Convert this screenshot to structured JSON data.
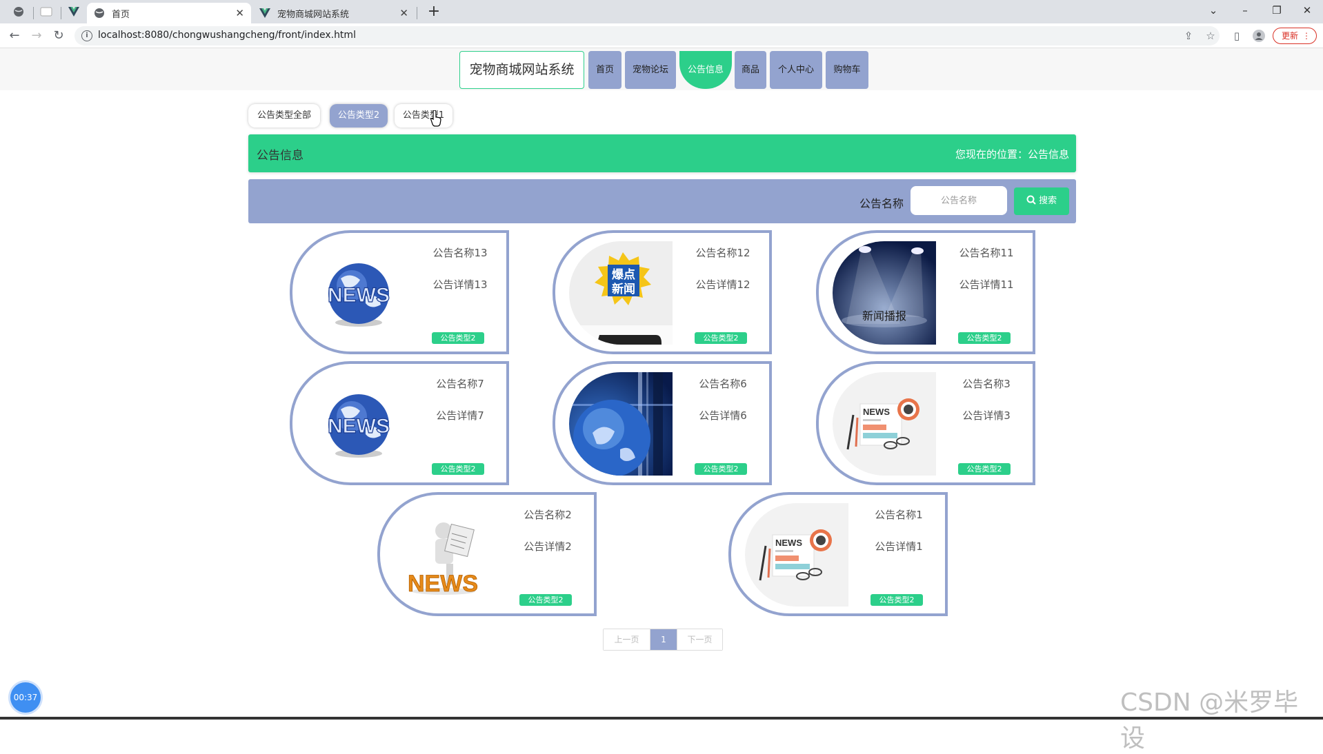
{
  "browser": {
    "tabs": [
      {
        "title": "首页",
        "icon": "globe-icon"
      },
      {
        "title": "宠物商城网站系统",
        "icon": "vue-icon"
      }
    ],
    "url": "localhost:8080/chongwushangcheng/front/index.html",
    "update_label": "更新"
  },
  "header": {
    "brand": "宠物商城网站系统",
    "nav": [
      "首页",
      "宠物论坛",
      "公告信息",
      "商品",
      "个人中心",
      "购物车"
    ],
    "active_nav": "公告信息"
  },
  "filters": {
    "chips": [
      "公告类型全部",
      "公告类型2",
      "公告类型1"
    ],
    "active": "公告类型2"
  },
  "titlebar": {
    "title": "公告信息",
    "location": "您现在的位置：公告信息"
  },
  "search": {
    "label": "公告名称",
    "placeholder": "公告名称",
    "button": "搜索"
  },
  "cards": [
    {
      "name": "公告名称13",
      "detail": "公告详情13",
      "tag": "公告类型2",
      "image": "news-globe"
    },
    {
      "name": "公告名称12",
      "detail": "公告详情12",
      "tag": "公告类型2",
      "image": "explosive-news"
    },
    {
      "name": "公告名称11",
      "detail": "公告详情11",
      "tag": "公告类型2",
      "image": "spotlight-stage",
      "image_text": "新闻播报"
    },
    {
      "name": "公告名称7",
      "detail": "公告详情7",
      "tag": "公告类型2",
      "image": "news-globe"
    },
    {
      "name": "公告名称6",
      "detail": "公告详情6",
      "tag": "公告类型2",
      "image": "earth-broadcast"
    },
    {
      "name": "公告名称3",
      "detail": "公告详情3",
      "tag": "公告类型2",
      "image": "newspaper-glasses"
    },
    {
      "name": "公告名称2",
      "detail": "公告详情2",
      "tag": "公告类型2",
      "image": "man-reading-news"
    },
    {
      "name": "公告名称1",
      "detail": "公告详情1",
      "tag": "公告类型2",
      "image": "newspaper-glasses"
    }
  ],
  "pagination": {
    "prev": "上一页",
    "current": "1",
    "next": "下一页"
  },
  "timer": "00:37",
  "watermark": "CSDN @米罗毕设",
  "colors": {
    "accent_green": "#2ccf8a",
    "accent_blue": "#93a3cf"
  }
}
